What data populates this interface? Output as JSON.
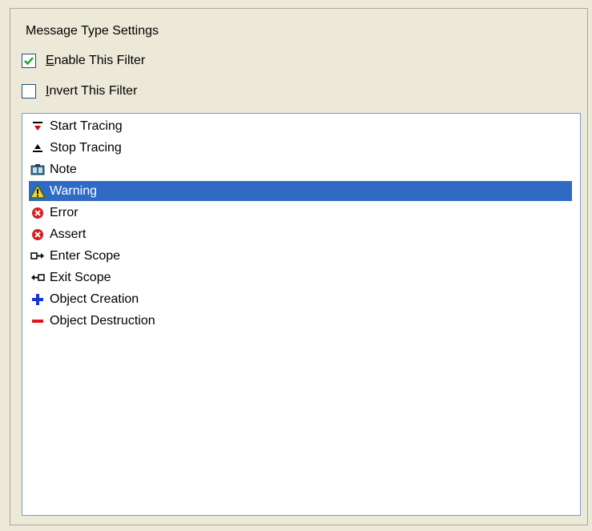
{
  "group": {
    "title": "Message Type Settings"
  },
  "options": [
    {
      "label_first": "E",
      "label_rest": "nable This Filter",
      "checked": true
    },
    {
      "label_first": "I",
      "label_rest": "nvert This Filter",
      "checked": false
    }
  ],
  "list": {
    "selected_index": 3,
    "items": [
      {
        "label": "Start Tracing",
        "icon": "start-tracing-icon"
      },
      {
        "label": "Stop Tracing",
        "icon": "stop-tracing-icon"
      },
      {
        "label": "Note",
        "icon": "note-icon"
      },
      {
        "label": "Warning",
        "icon": "warning-icon"
      },
      {
        "label": "Error",
        "icon": "error-icon"
      },
      {
        "label": "Assert",
        "icon": "assert-icon"
      },
      {
        "label": "Enter Scope",
        "icon": "enter-scope-icon"
      },
      {
        "label": "Exit Scope",
        "icon": "exit-scope-icon"
      },
      {
        "label": "Object Creation",
        "icon": "object-creation-icon"
      },
      {
        "label": "Object Destruction",
        "icon": "object-destruction-icon"
      }
    ]
  },
  "colors": {
    "selection": "#316ac5",
    "window_bg": "#ece9d8",
    "check_mark": "#21a121"
  }
}
